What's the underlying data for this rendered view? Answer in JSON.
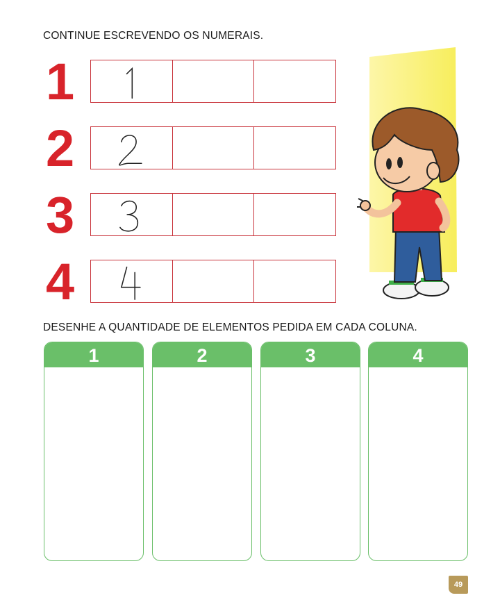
{
  "instructions": {
    "write": "CONTINUE ESCREVENDO OS NUMERAIS.",
    "draw": "DESENHE A QUANTIDADE DE ELEMENTOS PEDIDA EM CADA COLUNA."
  },
  "numerals": [
    {
      "big": "1",
      "traced": "1"
    },
    {
      "big": "2",
      "traced": "2"
    },
    {
      "big": "3",
      "traced": "3"
    },
    {
      "big": "4",
      "traced": "4"
    }
  ],
  "columns": [
    {
      "label": "1"
    },
    {
      "label": "2"
    },
    {
      "label": "3"
    },
    {
      "label": "4"
    }
  ],
  "page_number": "49",
  "colors": {
    "numeral_red": "#d8232a",
    "box_border": "#c8323a",
    "column_green": "#6abf69"
  }
}
